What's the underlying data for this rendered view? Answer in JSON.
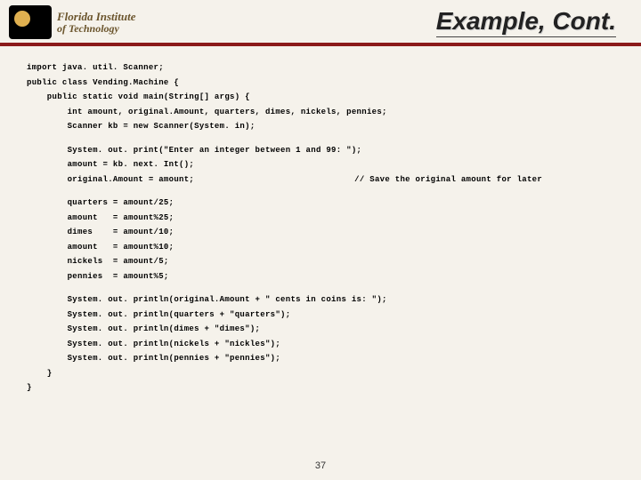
{
  "header": {
    "institution_line1": "Florida Institute",
    "institution_line2": "of Technology",
    "title": "Example, Cont."
  },
  "code": {
    "l01": "import java. util. Scanner;",
    "l02": "public class Vending.Machine {",
    "l03": "    public static void main(String[] args) {",
    "l04": "        int amount, original.Amount, quarters, dimes, nickels, pennies;",
    "l05": "        Scanner kb = new Scanner(System. in);",
    "l06": "        System. out. print(\"Enter an integer between 1 and 99: \");",
    "l07": "        amount = kb. next. Int();",
    "l08": "        original.Amount = amount;",
    "l08c": "// Save the original amount for later",
    "l09": "        quarters = amount/25;",
    "l10": "        amount   = amount%25;",
    "l11": "        dimes    = amount/10;",
    "l12": "        amount   = amount%10;",
    "l13": "        nickels  = amount/5;",
    "l14": "        pennies  = amount%5;",
    "l15": "        System. out. println(original.Amount + \" cents in coins is: \");",
    "l16": "        System. out. println(quarters + \"quarters\");",
    "l17": "        System. out. println(dimes + \"dimes\");",
    "l18": "        System. out. println(nickels + \"nickles\");",
    "l19": "        System. out. println(pennies + \"pennies\");",
    "l20": "    }",
    "l21": "}"
  },
  "page_number": "37"
}
